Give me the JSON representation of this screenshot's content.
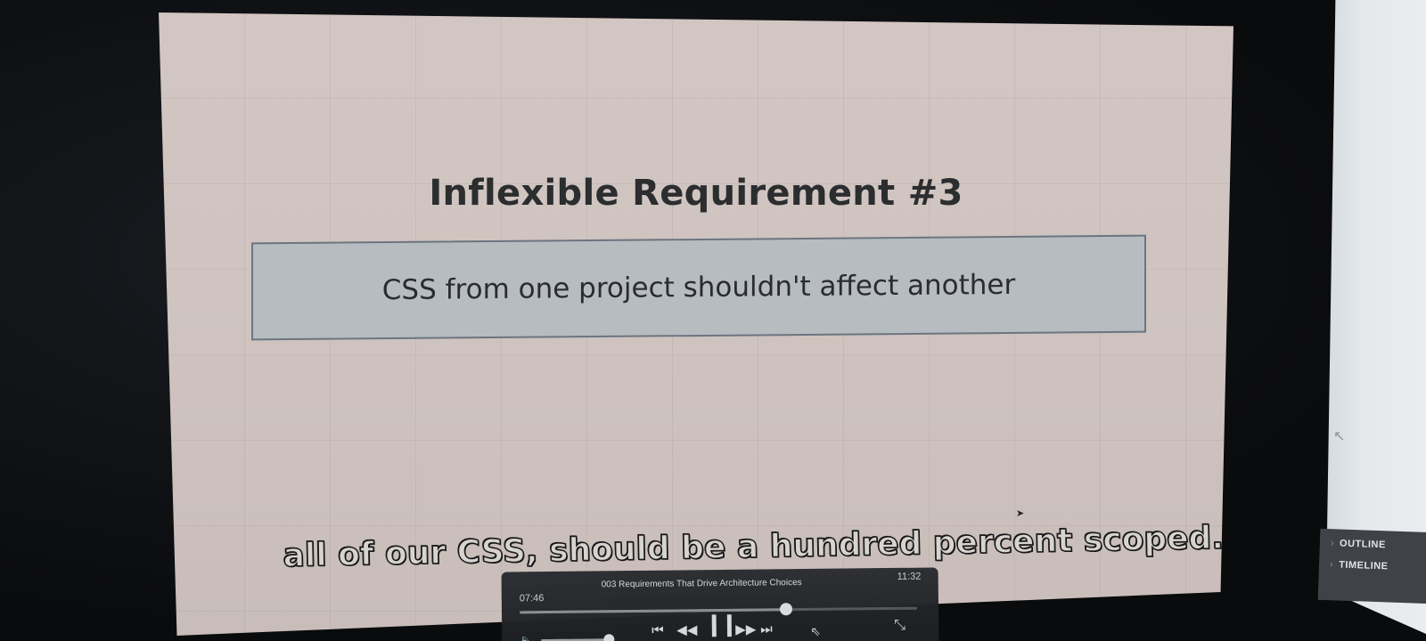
{
  "slide": {
    "title": "Inflexible Requirement #3",
    "box_text": "CSS from one project shouldn't affect another"
  },
  "subtitle": {
    "text": "all of our CSS, should be a hundred percent scoped."
  },
  "player": {
    "elapsed": "07:46",
    "video_title": "003 Requirements That Drive Architecture Choices",
    "remaining": "11:32",
    "progress": 0.67,
    "volume": 0.95,
    "icons": {
      "skip_back": "⏮",
      "rewind": "◀◀",
      "pause": "❙❙",
      "forward": "▶▶",
      "skip_forward": "⏭",
      "shrink": "⤡",
      "volume": "🔈",
      "cursor": "⇖"
    }
  },
  "side_panel": {
    "items": [
      {
        "label": "OUTLINE"
      },
      {
        "label": "TIMELINE"
      }
    ]
  },
  "colors": {
    "slide_bg": "#d2c6c2",
    "box_bg": "#b7bcc0",
    "player_bg": "#2a2c30"
  }
}
